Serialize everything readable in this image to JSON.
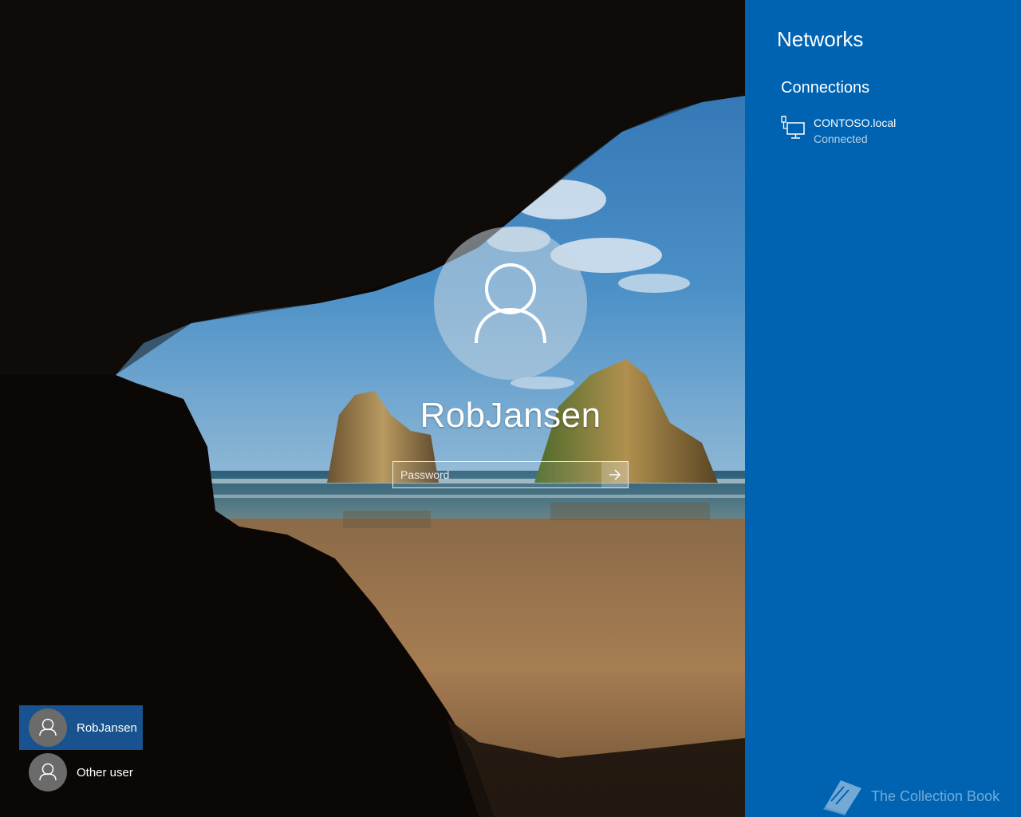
{
  "login": {
    "username": "RobJansen",
    "password_placeholder": "Password",
    "submit_icon": "arrow-right-icon",
    "avatar_icon": "user-icon"
  },
  "user_list": [
    {
      "label": "RobJansen",
      "selected": true,
      "icon": "user-icon"
    },
    {
      "label": "Other user",
      "selected": false,
      "icon": "user-icon"
    }
  ],
  "networks_pane": {
    "title": "Networks",
    "section_title": "Connections",
    "connections": [
      {
        "name": "CONTOSO.local",
        "status": "Connected",
        "icon": "wired-network-icon"
      }
    ],
    "background_color": "#0063b1"
  },
  "watermark": {
    "label": "The Collection Book",
    "icon": "book-icon"
  }
}
